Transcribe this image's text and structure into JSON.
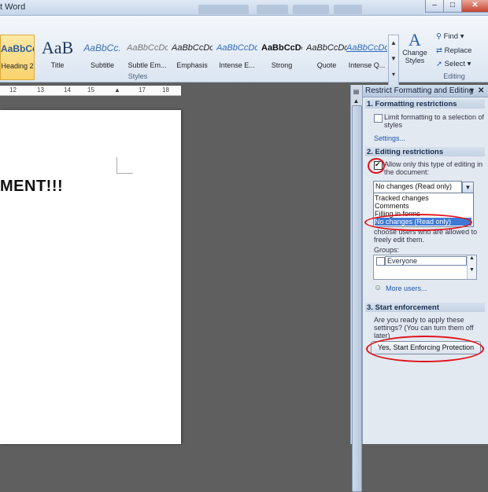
{
  "window": {
    "title": "t Word",
    "controls": {
      "minimize": "–",
      "maximize": "□",
      "close": "✕"
    }
  },
  "ribbon": {
    "styles_gallery": [
      {
        "preview": "AaBbCc",
        "label": "Heading 2",
        "color": "#2e5c9c"
      },
      {
        "preview": "AaB",
        "label": "Title",
        "color": "#1f3a5f"
      },
      {
        "preview": "AaBbCc.",
        "label": "Subtitle",
        "color": "#3c6fb0"
      },
      {
        "preview": "AaBbCcDc",
        "label": "Subtle Em...",
        "color": "#777777"
      },
      {
        "preview": "AaBbCcDc",
        "label": "Emphasis",
        "color": "#222222"
      },
      {
        "preview": "AaBbCcDc",
        "label": "Intense E...",
        "color": "#2e6bbd"
      },
      {
        "preview": "AaBbCcDc",
        "label": "Strong",
        "color": "#111111"
      },
      {
        "preview": "AaBbCcDc",
        "label": "Quote",
        "color": "#222222"
      },
      {
        "preview": "AaBbCcDc",
        "label": "Intense Q...",
        "color": "#2e6bbd"
      }
    ],
    "styles_group_label": "Styles",
    "change_styles": {
      "line1": "Change",
      "line2": "Styles"
    },
    "editing": {
      "find": "Find",
      "replace": "Replace",
      "select": "Select",
      "group_label": "Editing"
    }
  },
  "ruler": {
    "ticks": [
      "12",
      "13",
      "14",
      "15",
      "17",
      "18"
    ]
  },
  "document": {
    "text": "MENT!!!"
  },
  "pane": {
    "title": "Restrict Formatting and Editing",
    "section1": {
      "heading": "1. Formatting restrictions",
      "checkbox_label": "Limit formatting to a selection of styles",
      "settings_link": "Settings..."
    },
    "section2": {
      "heading": "2. Editing restrictions",
      "checkbox_label": "Allow only this type of editing in the document:",
      "select_value": "No changes (Read only)",
      "options": [
        "Tracked changes",
        "Comments",
        "Filling in forms",
        "No changes (Read only)"
      ],
      "users_text": "choose users who are allowed to freely edit them.",
      "groups_label": "Groups:",
      "group_item": "Everyone",
      "more_users": "More users..."
    },
    "section3": {
      "heading": "3. Start enforcement",
      "question": "Are you ready to apply these settings? (You can turn them off later)",
      "button": "Yes, Start Enforcing Protection"
    }
  },
  "colors": {
    "annotation": "#e0121a",
    "selection": "#3e79d6"
  }
}
